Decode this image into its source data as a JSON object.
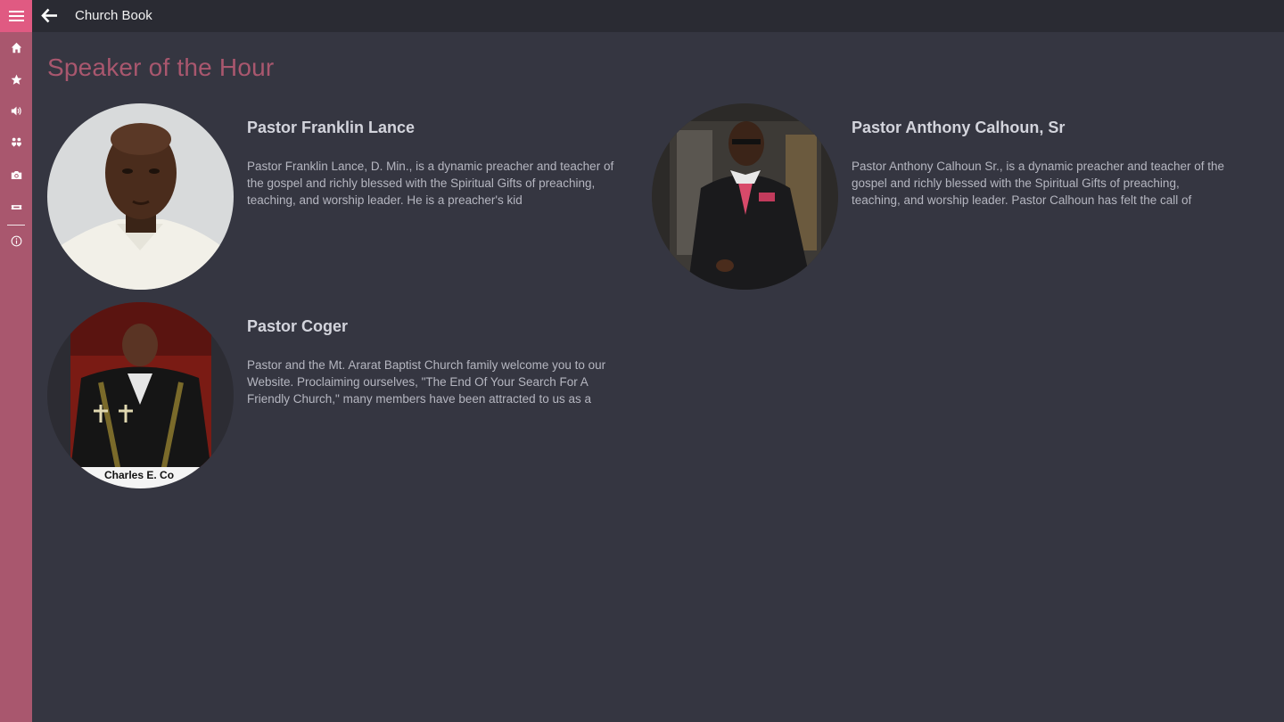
{
  "app": {
    "title": "Church Book"
  },
  "sidebar": {
    "menu_icon": "hamburger-menu-icon",
    "items": [
      {
        "name": "home",
        "icon": "home-icon"
      },
      {
        "name": "favorites",
        "icon": "star-icon"
      },
      {
        "name": "audio",
        "icon": "speaker-volume-icon"
      },
      {
        "name": "community",
        "icon": "people-icon"
      },
      {
        "name": "photos",
        "icon": "camera-icon"
      },
      {
        "name": "events",
        "icon": "ticket-icon"
      },
      {
        "name": "about",
        "icon": "info-icon"
      }
    ]
  },
  "page": {
    "heading": "Speaker of the Hour"
  },
  "speakers": [
    {
      "name": "Pastor Franklin Lance",
      "description": "Pastor Franklin Lance, D. Min., is a dynamic preacher and teacher of the gospel and richly blessed with the Spiritual Gifts of preaching, teaching, and worship leader. He is a preacher's kid"
    },
    {
      "name": "Pastor Anthony Calhoun, Sr",
      "description": "Pastor Anthony Calhoun Sr., is a dynamic preacher and teacher of the gospel and richly blessed with the Spiritual Gifts of preaching, teaching, and worship leader. Pastor Calhoun has felt the call of"
    },
    {
      "name": "Pastor Coger",
      "description": "Pastor and the Mt. Ararat Baptist Church family welcome you to our Website. Proclaiming ourselves, \"The End Of Your Search For A Friendly Church,\" many members have been attracted to us as a",
      "photo_caption": "Charles E. Co"
    }
  ],
  "colors": {
    "accent": "#a9576e",
    "accent_bright": "#e05a82",
    "background": "#353641",
    "topbar": "#2a2b33"
  }
}
